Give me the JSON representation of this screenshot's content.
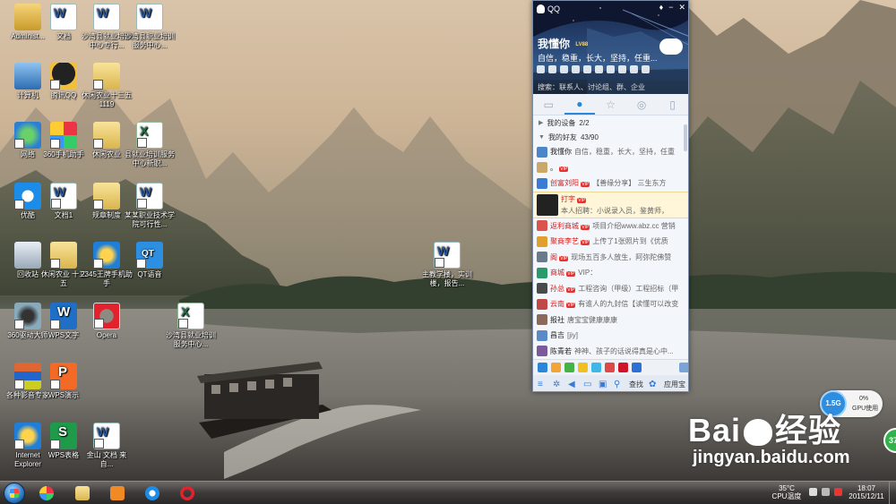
{
  "desktop": {
    "icons": [
      {
        "label": "Administ...",
        "icon": "user-folder-icon"
      },
      {
        "label": "文档",
        "icon": "word-doc-icon"
      },
      {
        "label": "沙湾县就业培训中心专行...",
        "icon": "word-doc-icon"
      },
      {
        "label": "沙湾县职业培训服务中心...",
        "icon": "word-doc-icon"
      },
      {
        "label": "计算机",
        "icon": "computer-icon"
      },
      {
        "label": "腾讯QQ",
        "icon": "qq-penguin-icon"
      },
      {
        "label": "休闲农业十三五1119",
        "icon": "folder-icon"
      },
      {
        "label": "网络",
        "icon": "network-globe-icon"
      },
      {
        "label": "360手机助手",
        "icon": "360-assistant-icon"
      },
      {
        "label": "休闲农业",
        "icon": "folder-icon"
      },
      {
        "label": "县就业培训服务中心新职...",
        "icon": "excel-sheet-icon"
      },
      {
        "label": "优酷",
        "icon": "youku-play-icon"
      },
      {
        "label": "文档1",
        "icon": "word-doc-icon"
      },
      {
        "label": "规章制度",
        "icon": "folder-icon"
      },
      {
        "label": "某某职业技术学院可行性...",
        "icon": "word-doc-icon"
      },
      {
        "label": "回收站",
        "icon": "recycle-bin-icon"
      },
      {
        "label": "休闲农业 十三五",
        "icon": "folder-icon"
      },
      {
        "label": "2345王牌手机助手",
        "icon": "ie-browser-icon"
      },
      {
        "label": "QT语音",
        "icon": "qt-voice-icon"
      },
      {
        "label": "主教学楼，实训楼，报告...",
        "icon": "word-doc-icon"
      },
      {
        "label": "360驱动大师",
        "icon": "driver-gear-icon"
      },
      {
        "label": "WPS文字",
        "icon": "wps-writer-icon"
      },
      {
        "label": "Opera",
        "icon": "opera-icon"
      },
      {
        "label": "沙湾县就业培训服务中心...",
        "icon": "excel-sheet-icon"
      },
      {
        "label": "各种影音专家",
        "icon": "media-player-icon"
      },
      {
        "label": "WPS演示",
        "icon": "wps-presentation-icon"
      },
      {
        "label": "Internet Explorer",
        "icon": "ie-browser-icon"
      },
      {
        "label": "WPS表格",
        "icon": "wps-sheet-icon"
      },
      {
        "label": "金山 文档 来自...",
        "icon": "word-doc-icon"
      }
    ]
  },
  "qq": {
    "title": "QQ",
    "nickname": "我懂你",
    "level_badge": "LV88",
    "signature": "自信，稳重，长大，坚持，任重...",
    "search_placeholder": "搜索：联系人、讨论组、群、企业",
    "tabs": [
      "消息",
      "联系人",
      "收藏",
      "群",
      "设备"
    ],
    "groups": [
      {
        "label": "我的设备",
        "count": "2/2"
      },
      {
        "label": "我的好友",
        "count": "43/90"
      }
    ],
    "friends": [
      {
        "name": "我懂你",
        "signature": "自信，稳重，长大，坚持，任重",
        "red": false,
        "vip": false
      },
      {
        "name": "。",
        "signature": "",
        "red": false,
        "vip": true
      },
      {
        "name": "创富刘阳",
        "signature": "【善缘分享】 三生东方",
        "red": true,
        "vip": true
      },
      {
        "name": "打字",
        "signature": "本人招聘：小说录入员，鉴黄师，",
        "red": true,
        "vip": true
      },
      {
        "name": "返利商城",
        "signature": "项目介绍www.abz.cc 营销",
        "red": true,
        "vip": true
      },
      {
        "name": "聚商李艺",
        "signature": "上传了1张照片到《优质",
        "red": true,
        "vip": true
      },
      {
        "name": "阁",
        "signature": "现场五百多人放生，阿弥陀佛赞",
        "red": true,
        "vip": true
      },
      {
        "name": "商城",
        "signature": "VIP：",
        "red": true,
        "vip": true
      },
      {
        "name": "孙总",
        "signature": "工程咨询（甲级）工程招标（甲",
        "red": true,
        "vip": true
      },
      {
        "name": "云南",
        "signature": "有谁人的九封信【读懂可以改变",
        "red": true,
        "vip": true
      },
      {
        "name": "报社",
        "signature": "唐宝宝健康康康",
        "red": false,
        "vip": false
      },
      {
        "name": "昌吉",
        "signature": "[jiy]",
        "red": false,
        "vip": false
      },
      {
        "name": "陈青若",
        "signature": "神神、孩子的话说得真是心中...",
        "red": false,
        "vip": false
      }
    ],
    "bottom": {
      "find_label": "查找",
      "app_label": "应用宝"
    }
  },
  "widgets": {
    "memory": "1.5G",
    "gpu_percent": "0%",
    "gpu_label": "GPU使用",
    "green_badge": "37"
  },
  "watermark": {
    "brand": "Bai",
    "brand_cn": "经验",
    "url": "jingyan.baidu.com"
  },
  "taskbar": {
    "temp": "35°C",
    "temp_label": "CPU温度",
    "time": "18:07",
    "date": "2015/12/11"
  },
  "colors": {
    "qq_accent": "#2a86d8",
    "vip_red": "#e8322d"
  }
}
